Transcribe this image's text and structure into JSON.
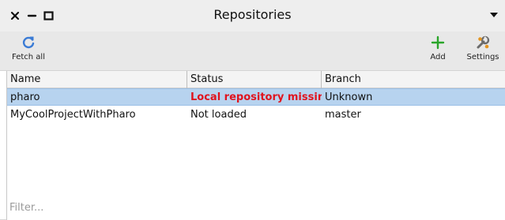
{
  "window": {
    "title": "Repositories",
    "controls": {
      "close_icon": "close-icon",
      "minimize_icon": "minimize-icon",
      "maximize_icon": "maximize-icon"
    },
    "menu_icon": "chevron-down-icon"
  },
  "toolbar": {
    "fetch_all": {
      "label": "Fetch all",
      "icon": "refresh-icon",
      "color": "#3a7bd5"
    },
    "add": {
      "label": "Add",
      "icon": "plus-icon",
      "color": "#2aa52a"
    },
    "settings": {
      "label": "Settings",
      "icon": "wrench-icon"
    }
  },
  "table": {
    "columns": [
      "Name",
      "Status",
      "Branch"
    ],
    "rows": [
      {
        "name": "pharo",
        "status": "Local repository missing",
        "branch": "Unknown",
        "selected": true,
        "status_color": "#e0141e"
      },
      {
        "name": "MyCoolProjectWithPharo",
        "status": "Not loaded",
        "branch": "master",
        "selected": false
      }
    ]
  },
  "filter": {
    "placeholder": "Filter...",
    "value": ""
  },
  "colors": {
    "selection": "#b7d3ef",
    "error": "#e0141e"
  }
}
